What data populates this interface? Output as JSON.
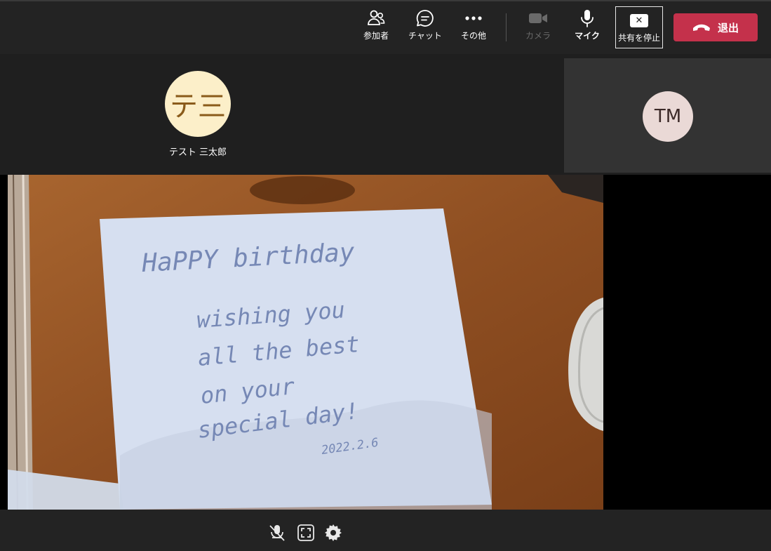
{
  "toolbar": {
    "participants_label": "参加者",
    "chat_label": "チャット",
    "more_label": "その他",
    "camera_label": "カメラ",
    "mic_label": "マイク",
    "stop_share_label": "共有を停止",
    "leave_label": "退出",
    "leave_color": "#c4314b"
  },
  "participants": [
    {
      "initials": "テ三",
      "name": "テスト 三太郎",
      "avatar_color": "#fcefc9"
    },
    {
      "initials": "TM",
      "avatar_color": "#ead9d6"
    }
  ],
  "shared_video": {
    "note_lines": [
      "HaPPY birthday",
      "wishing you",
      "all the best",
      "on your",
      "special day!",
      "2022.2.6"
    ]
  },
  "bottom_controls": {
    "icons": [
      "mic-off-icon",
      "fullscreen-icon",
      "settings-icon"
    ]
  }
}
